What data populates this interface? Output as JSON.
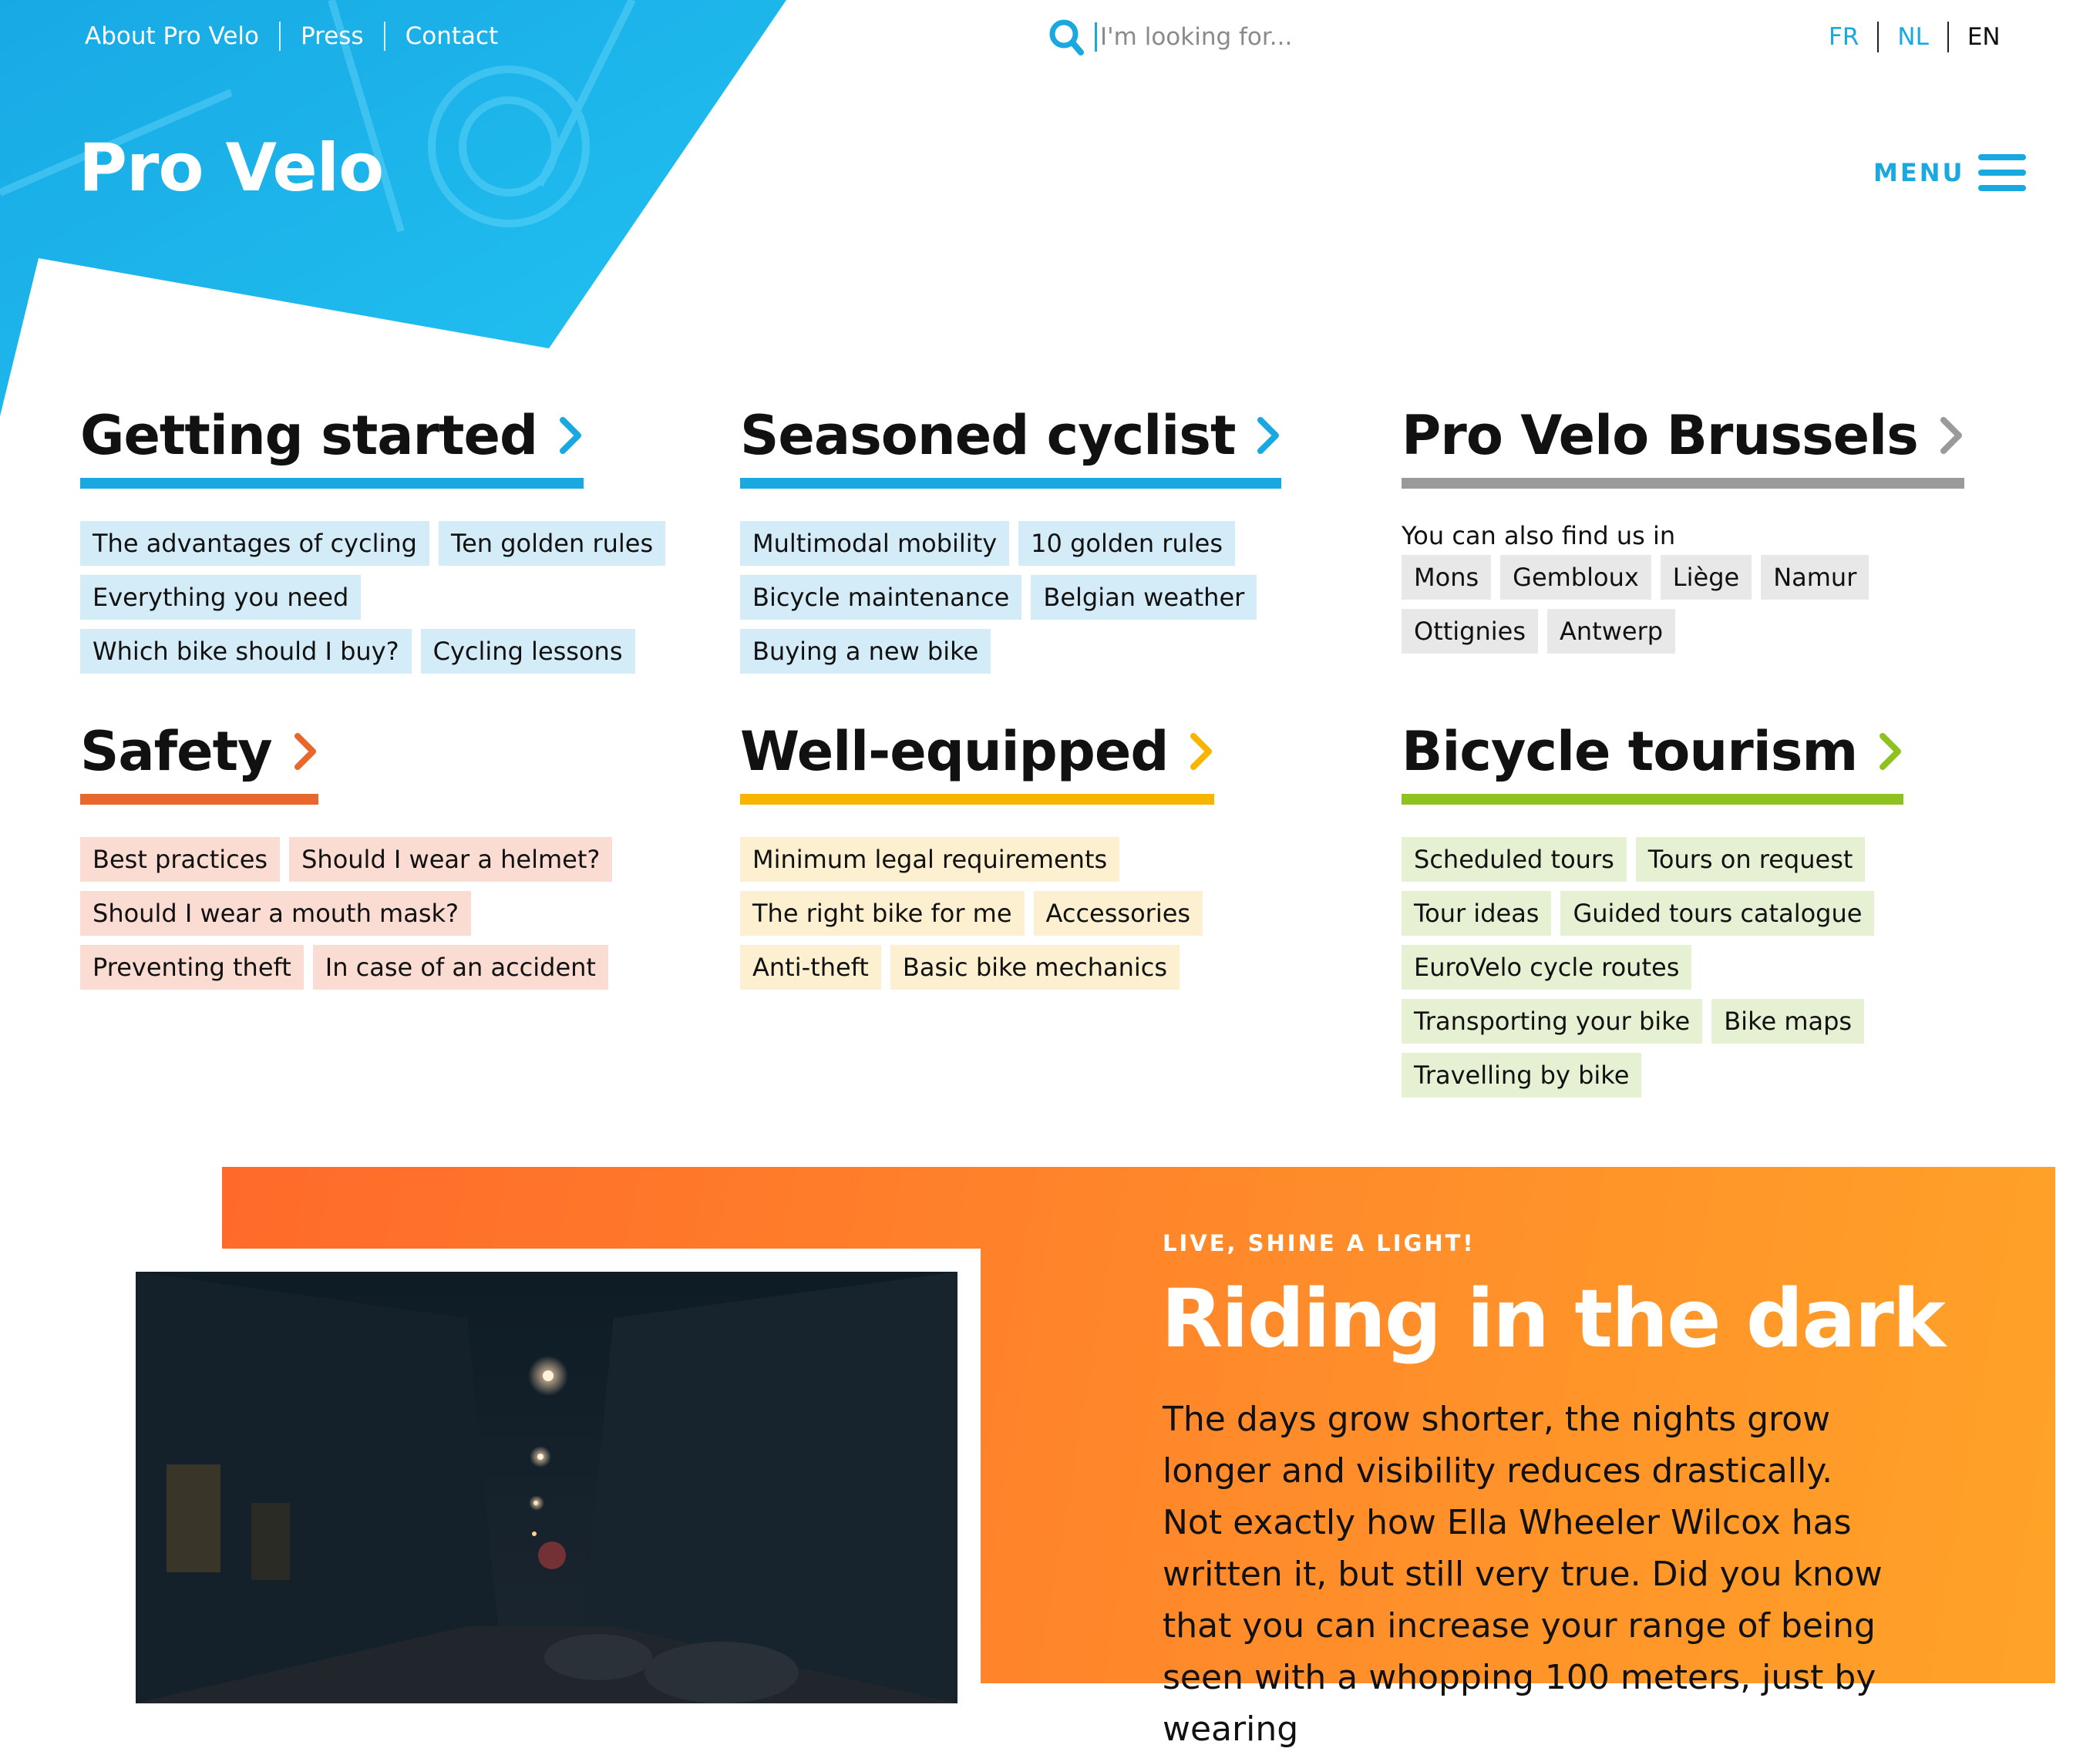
{
  "top_nav": {
    "links": [
      "About Pro Velo",
      "Press",
      "Contact"
    ]
  },
  "search": {
    "placeholder": "I'm looking for..."
  },
  "languages": [
    {
      "code": "FR",
      "color": "#1aa8e0"
    },
    {
      "code": "NL",
      "color": "#1aa8e0"
    },
    {
      "code": "EN",
      "color": "#111111"
    }
  ],
  "logo": "Pro Velo",
  "menu": {
    "label": "MENU"
  },
  "colors": {
    "blue": "#1aa8e0",
    "grey": "#9a9a9a",
    "orange": "#e8672c",
    "yellow": "#f7b500",
    "green": "#8fc121"
  },
  "categories": [
    {
      "title": "Getting started",
      "bar_color": "#1aa8e0",
      "chevron_color": "#1aa8e0",
      "tag_bg": "#d4ecf7",
      "tags": [
        "The advantages of cycling",
        "Ten golden rules",
        "Everything you need",
        "Which bike should I buy?",
        "Cycling lessons"
      ]
    },
    {
      "title": "Seasoned cyclist",
      "bar_color": "#1aa8e0",
      "chevron_color": "#1aa8e0",
      "tag_bg": "#d4ecf7",
      "tags": [
        "Multimodal mobility",
        "10 golden rules",
        "Bicycle maintenance",
        "Belgian weather",
        "Buying a new bike"
      ]
    },
    {
      "title": "Pro Velo Brussels",
      "bar_color": "#9a9a9a",
      "chevron_color": "#9a9a9a",
      "tag_bg": "#e8e8e8",
      "note": "You can also find us in",
      "tags": [
        "Mons",
        "Gembloux",
        "Liège",
        "Namur",
        "Ottignies",
        "Antwerp"
      ]
    },
    {
      "title": "Safety",
      "bar_color": "#e8672c",
      "chevron_color": "#e8672c",
      "tag_bg": "#fbdcd2",
      "tags": [
        "Best practices",
        "Should I wear a helmet?",
        "Should I wear a mouth mask?",
        "Preventing theft",
        "In case of an accident"
      ]
    },
    {
      "title": "Well-equipped",
      "bar_color": "#f7b500",
      "chevron_color": "#f7b500",
      "tag_bg": "#fdf0d0",
      "tags": [
        "Minimum legal requirements",
        "The right bike for me",
        "Accessories",
        "Anti-theft",
        "Basic bike mechanics"
      ]
    },
    {
      "title": "Bicycle tourism",
      "bar_color": "#8fc121",
      "chevron_color": "#8fc121",
      "tag_bg": "#e6f1d3",
      "tags": [
        "Scheduled tours",
        "Tours on request",
        "Tour ideas",
        "Guided tours catalogue",
        "EuroVelo cycle routes",
        "Transporting your bike",
        "Bike maps",
        "Travelling by bike"
      ]
    }
  ],
  "feature": {
    "kicker": "LIVE, SHINE A LIGHT!",
    "title": "Riding in the dark",
    "body": "The days grow shorter, the nights grow longer and visibility reduces drastically. Not exactly how Ella Wheeler Wilcox has written it, but still very true. Did you know that you can increase your range of being seen with a whopping 100 meters, just by wearing"
  }
}
